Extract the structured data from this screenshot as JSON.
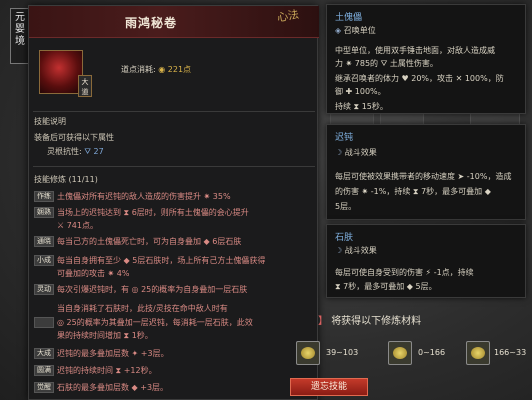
{
  "realm": "元婴境",
  "panel": {
    "title": "雨鸿秘卷",
    "calligraphy": "心法",
    "tier_badge": "大道",
    "cost_label": "道点消耗:",
    "cost_icon": "◉",
    "cost_value": "221点",
    "section_desc": "技能说明",
    "equip_note": "装备后可获得以下属性",
    "resist_label": "灵根抗性:",
    "resist_icon": "⛛",
    "resist_value": "27",
    "section_train": "技能修炼 (11/11)",
    "rows": [
      {
        "badge": "作练",
        "text": "土傀儡对所有迟钝的敌人造成的伤害提升 ✷ 35%"
      },
      {
        "badge": "娴熟",
        "text": "当场上的迟钝达到 ⧗ 6层时，则所有土傀儡的会心提升"
      },
      {
        "badge": "",
        "text": "⚔ 741点。"
      },
      {
        "badge": "通晓",
        "text": "每当己方的土傀儡死亡时，可为自身叠加 ◆ 6层石肤"
      },
      {
        "badge": "小成",
        "text": "每当自身拥有至少 ◆ 5层石肤时，场上所有己方土傀儡获得"
      },
      {
        "badge": "",
        "text": "可叠加的攻击 ✷ 4%"
      },
      {
        "badge": "灵动",
        "text": "每次引爆迟钝时，有 ◎ 25的概率为自身叠加一层石肤"
      },
      {
        "badge": "精通",
        "text": "当自身消耗了石肤时，此技/灵技在命中敌人时有"
      },
      {
        "badge": "",
        "text": "◎ 25的概率为其叠加一层迟钝，每消耗一层石肤，此效"
      },
      {
        "badge": "",
        "text": "果的持续时间增加 ⧗ 1秒。"
      },
      {
        "badge": "大成",
        "text": "迟钝的最多叠加层数 ✦ +3层。"
      },
      {
        "badge": "圆满",
        "text": "迟钝的持续时间 ⧗ +12秒。"
      },
      {
        "badge": "觉醒",
        "text": "石肤的最多叠加层数 ◆ +3层。"
      }
    ]
  },
  "cards": [
    {
      "title": "土傀儡",
      "sub": "召唤单位",
      "lines": [
        "中型单位，使用双手锤击地面，对敌人造成威",
        "力 ✷ 785的 ⛛ 土属性伤害。",
        "继承召唤者的体力 ♥ 20%，攻击 ✕ 100%，防",
        "御 ✚ 100%。",
        "持续 ⧗ 15秒。"
      ]
    },
    {
      "title": "迟钝",
      "sub": "战斗效果",
      "lines": [
        "每层可使被效果携带者的移动速度 ➤ -10%，造成",
        "的伤害 ✷ -1%，持续 ⧗ 7秒，最多可叠加 ◆",
        "5层。"
      ]
    },
    {
      "title": "石肤",
      "sub": "战斗效果",
      "lines": [
        "每层可使自身受到的伤害 ⚡ -1点，持续",
        "⧗ 7秒，最多可叠加 ◆ 5层。"
      ]
    }
  ],
  "materials": {
    "title": "将获得以下修炼材料",
    "items": [
      {
        "icon": "coin-icon",
        "count": "39~103"
      },
      {
        "icon": "coin-icon",
        "count": "0~166"
      },
      {
        "icon": "coin-icon",
        "count": "166~33"
      }
    ]
  },
  "forget_button": "遗忘技能"
}
